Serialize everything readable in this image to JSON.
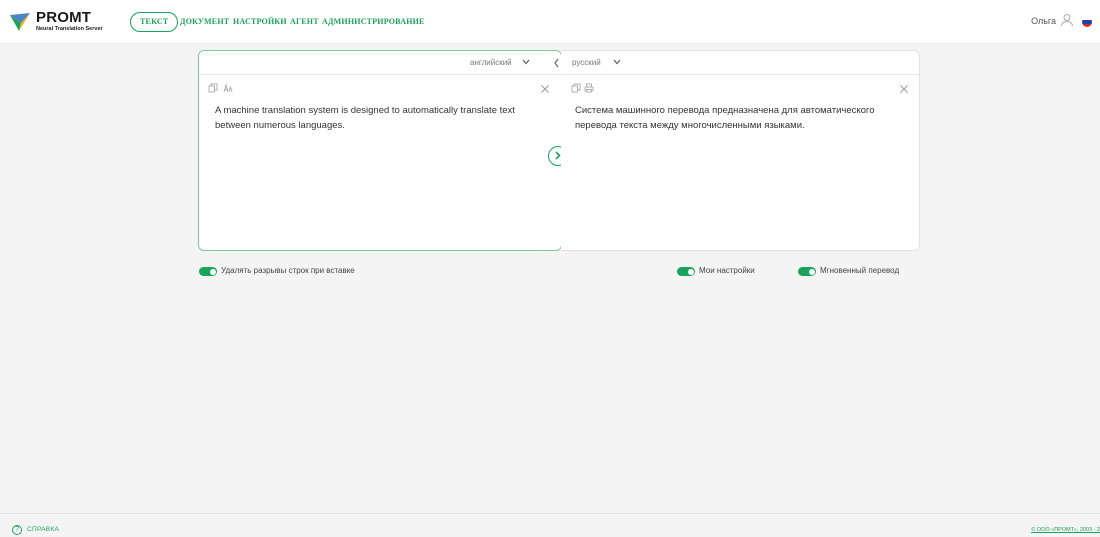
{
  "header": {
    "logo": {
      "word": "PROMT",
      "subtitle": "Neural Translation Server"
    },
    "nav": [
      {
        "label": "ТЕКСТ",
        "active": true
      },
      {
        "label": "ДОКУМЕНТ",
        "active": false
      },
      {
        "label": "НАСТРОЙКИ",
        "active": false
      },
      {
        "label": "АГЕНТ",
        "active": false
      },
      {
        "label": "АДМИНИСТРИРОВАНИЕ",
        "active": false
      }
    ],
    "user_name": "Ольга",
    "flag_colors": [
      "#ffffff",
      "#1c3faa",
      "#d52b1e"
    ]
  },
  "source": {
    "language": "английский",
    "text": "A machine translation system is designed to automatically translate text between numerous languages."
  },
  "target": {
    "language": "русский",
    "text": "Система машинного перевода предназначена для автоматического перевода текста между многочисленными языками."
  },
  "options": {
    "remove_breaks": {
      "label": "Удалять разрывы строк при вставке",
      "on": true
    },
    "my_settings": {
      "label": "Мои настройки",
      "on": true
    },
    "instant": {
      "label": "Мгновенный перевод",
      "on": true
    }
  },
  "footer": {
    "help": "СПРАВКА",
    "copyright": "© ООО «ПРОМТ», 2003 - 2"
  },
  "colors": {
    "accent": "#1aa35a",
    "panel_border": "#7cc9a0",
    "background": "#f4f4f5"
  }
}
